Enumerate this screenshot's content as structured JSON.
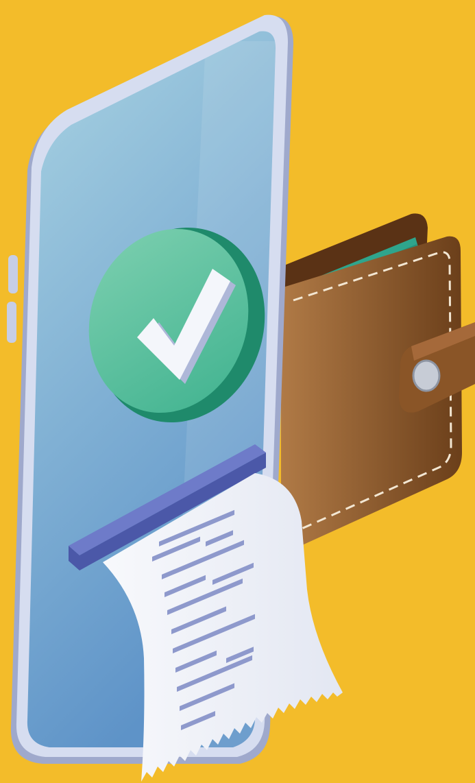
{
  "scene": {
    "background_color": "#F3BC2A",
    "subject": "phone-payment-illustration"
  },
  "phone": {
    "frame_color": "#D6DDF0",
    "frame_shadow_color": "#9FA9CC",
    "screen_top_color": "#A9D3E2",
    "screen_bottom_color": "#5E93C8",
    "side_button_color": "#C7CEE6"
  },
  "check_badge": {
    "icon": "checkmark-icon",
    "face_color": "#3FB28F",
    "edge_color": "#1F8A6B",
    "highlight_color": "#7ED0B0",
    "check_color": "#F4F6FB",
    "check_shadow_color": "#AEB7D8"
  },
  "wallet": {
    "icon": "wallet-icon",
    "leather_light": "#B07A46",
    "leather_dark": "#6B3F1A",
    "back_color": "#5A3215",
    "stitch_color": "#F3E7D3",
    "cash_color": "#2FA58C",
    "clasp_color": "#C7CCD6"
  },
  "receipt": {
    "icon": "receipt-icon",
    "slot_color": "#6E7BC9",
    "slot_dark": "#4B58A8",
    "paper_color": "#F8F9FC",
    "paper_shade": "#E3E7F2",
    "line_color": "#8E99CC"
  }
}
